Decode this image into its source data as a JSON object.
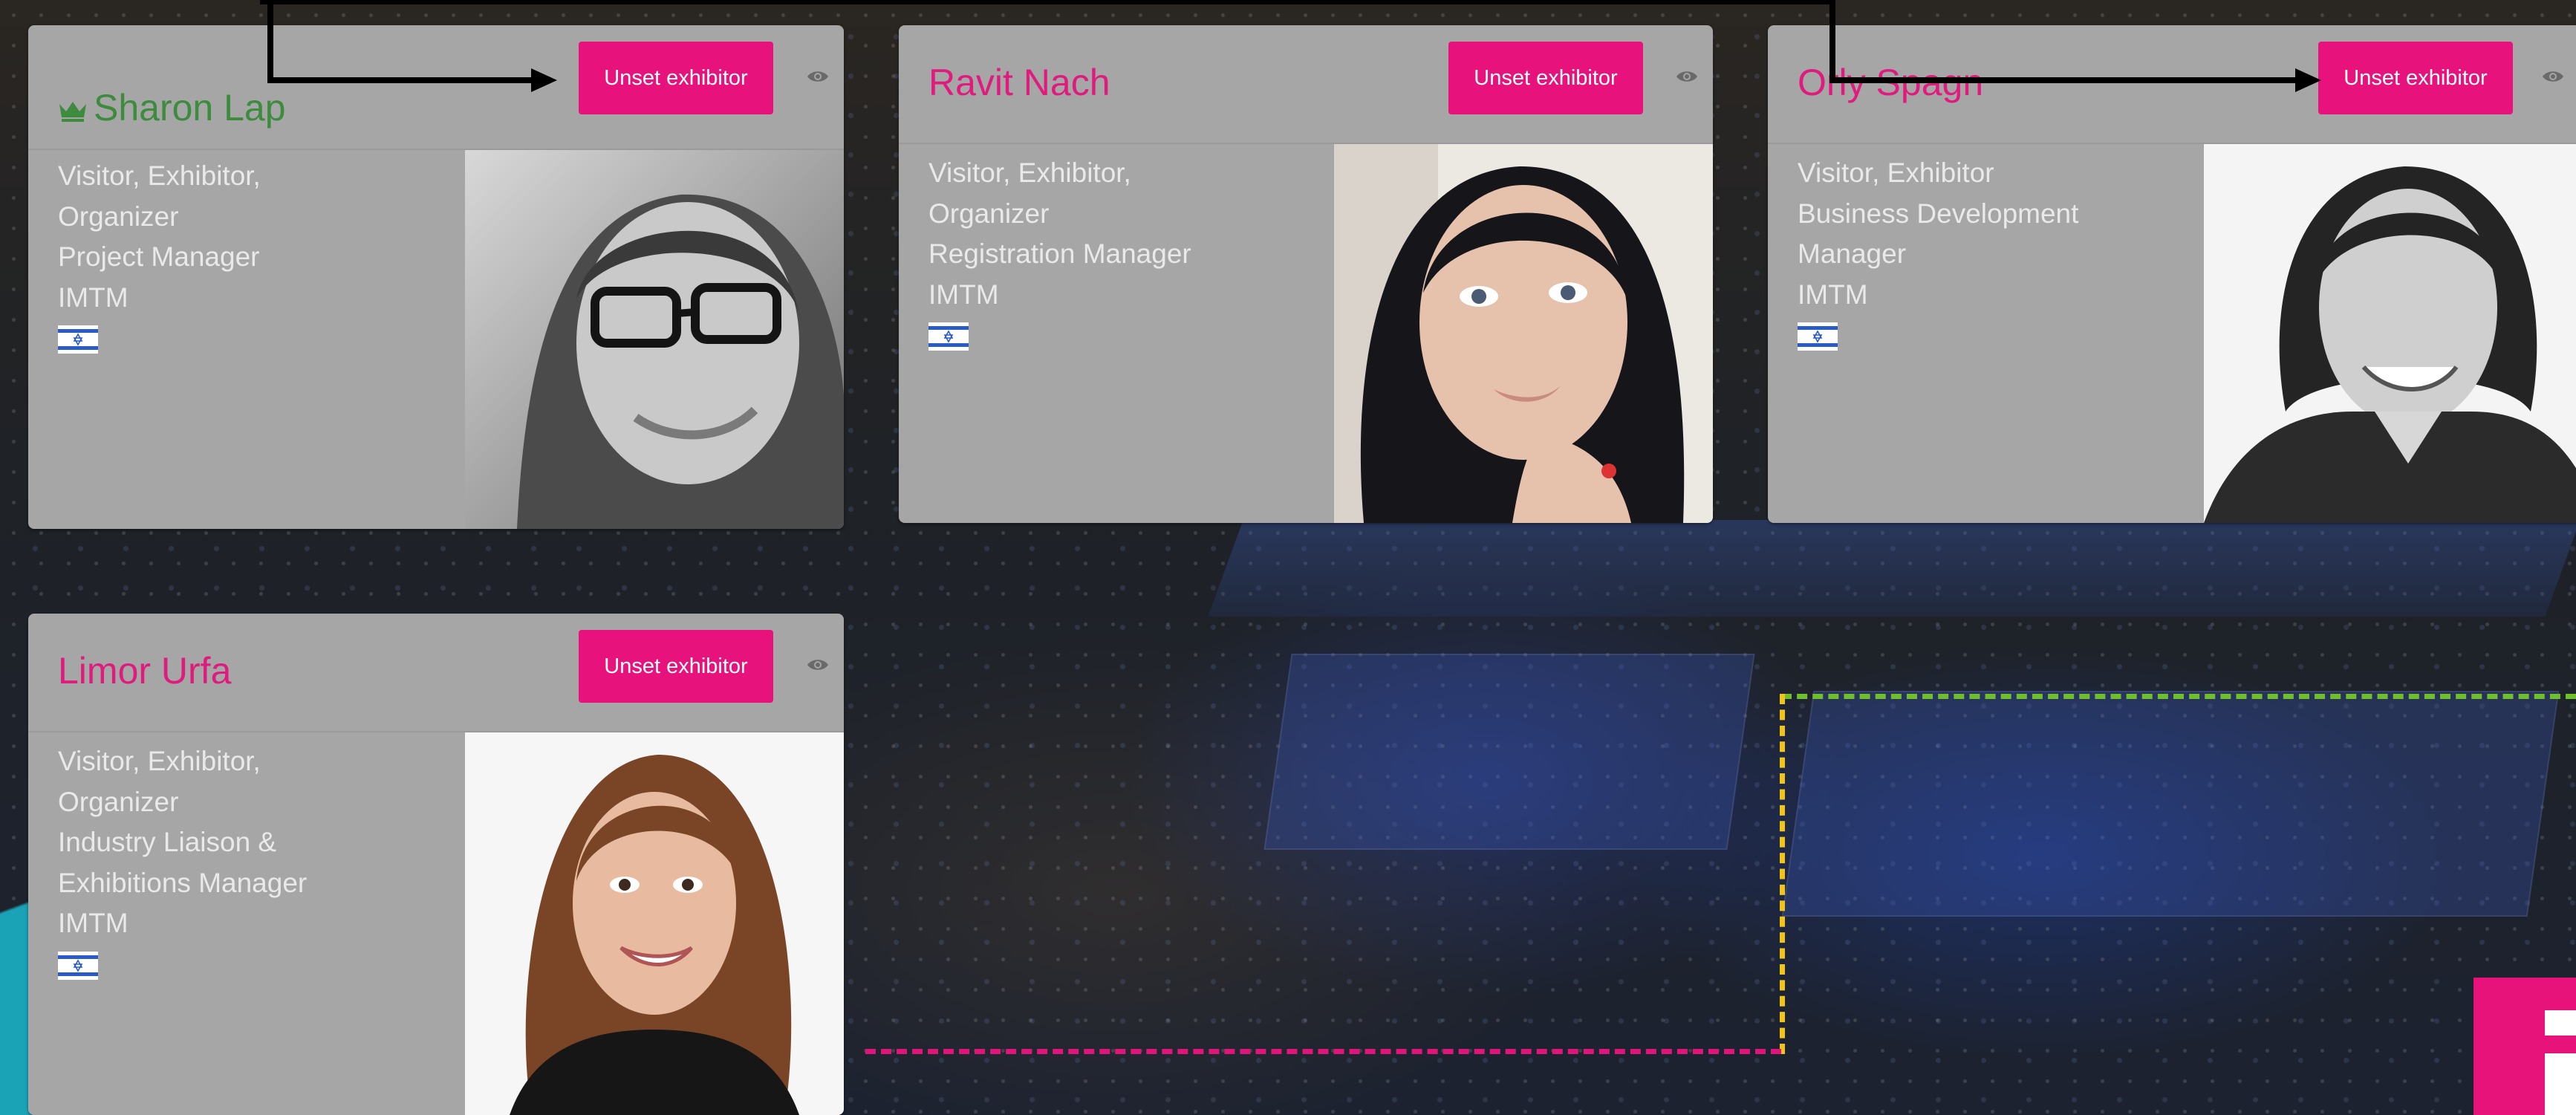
{
  "button_label": "Unset exhibitor",
  "cards": [
    {
      "name": "Sharon Lap",
      "is_organizer": true,
      "roles_line1": "Visitor, Exhibitor,",
      "roles_line2": "Organizer",
      "title_line1": "Project Manager",
      "company": "IMTM",
      "flag": "israel-flag"
    },
    {
      "name": "Ravit Nach",
      "is_organizer": false,
      "roles_line1": "Visitor, Exhibitor,",
      "roles_line2": "Organizer",
      "title_line1": "Registration Manager",
      "company": "IMTM",
      "flag": "israel-flag"
    },
    {
      "name": "Orly Spagn",
      "is_organizer": false,
      "roles_line1": "Visitor, Exhibitor",
      "title_line1": "Business Development",
      "title_line2": "Manager",
      "company": "IMTM",
      "flag": "israel-flag"
    },
    {
      "name": "Limor Urfa",
      "is_organizer": false,
      "roles_line1": "Visitor, Exhibitor,",
      "roles_line2": "Organizer",
      "title_line1": "Industry Liaison &",
      "title_line2": "Exhibitions Manager",
      "company": "IMTM",
      "flag": "israel-flag"
    }
  ],
  "colors": {
    "accent_pink": "#e8127c",
    "name_pink": "#e01b7e",
    "organizer_green": "#3d8b3d",
    "card_bg": "#a6a6a6",
    "dotted_green": "#6fbf2a",
    "dotted_yellow": "#f0c419",
    "dotted_pink": "#e0157a",
    "teal": "#1aa3b6"
  }
}
